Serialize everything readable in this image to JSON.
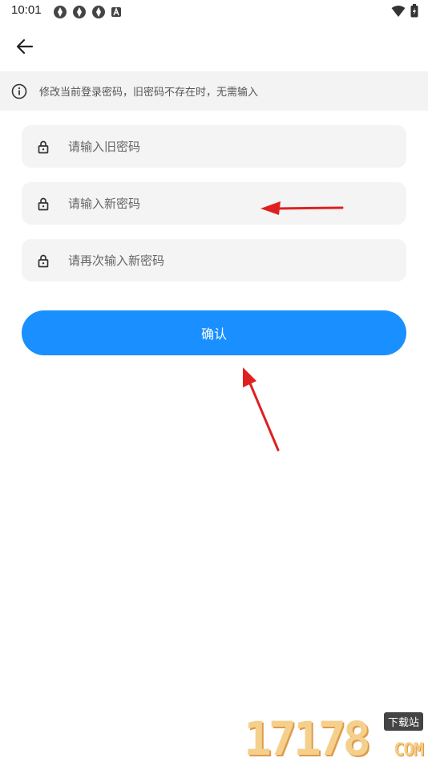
{
  "status_bar": {
    "time": "10:01",
    "left_icons": [
      "app-icon",
      "app-icon",
      "app-icon",
      "a-badge-icon"
    ],
    "right_icons": [
      "wifi-icon",
      "battery-icon"
    ]
  },
  "header": {
    "back_icon": "arrow-left-icon"
  },
  "notice": {
    "icon": "info-icon",
    "text": "修改当前登录密码，旧密码不存在时，无需输入"
  },
  "form": {
    "old_password": {
      "placeholder": "请输入旧密码",
      "value": ""
    },
    "new_password": {
      "placeholder": "请输入新密码",
      "value": ""
    },
    "confirm_password": {
      "placeholder": "请再次输入新密码",
      "value": ""
    }
  },
  "confirm_label": "确认",
  "watermark": {
    "digits": "17178",
    "tag": "下载站",
    "suffix": "COM"
  },
  "colors": {
    "primary": "#1a8fff",
    "field_bg": "#f4f4f4",
    "notice_bg": "#f3f3f3",
    "annotation_arrow": "#e02020"
  }
}
